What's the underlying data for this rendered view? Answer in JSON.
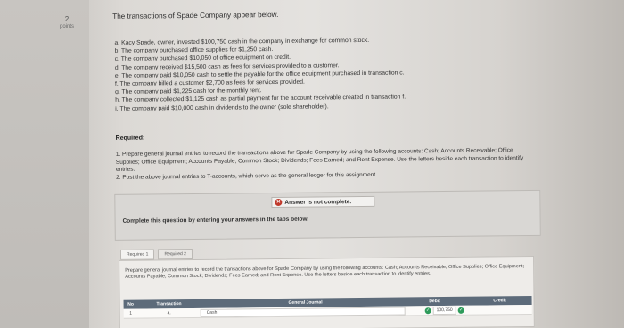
{
  "question": {
    "points_value": "2",
    "points_label": "points",
    "intro": "The transactions of Spade Company appear below.",
    "transactions": [
      "a. Kacy Spade, owner, invested $100,750 cash in the company in exchange for common stock.",
      "b. The company purchased office supplies for $1,250 cash.",
      "c. The company purchased $10,050 of office equipment on credit.",
      "d. The company received $15,500 cash as fees for services provided to a customer.",
      "e. The company paid $10,050 cash to settle the payable for the office equipment purchased in transaction c.",
      "f. The company billed a customer $2,700 as fees for services provided.",
      "g. The company paid $1,225 cash for the monthly rent.",
      "h. The company collected $1,125 cash as partial payment for the account receivable created in transaction f.",
      "i. The company paid $10,000 cash in dividends to the owner (sole shareholder)."
    ],
    "required_label": "Required:",
    "requirements": [
      "1. Prepare general journal entries to record the transactions above for Spade Company by using the following accounts: Cash; Accounts Receivable; Office Supplies; Office Equipment; Accounts Payable; Common Stock; Dividends; Fees Earned; and Rent Expense. Use the letters beside each transaction to identify entries.",
      "2. Post the above journal entries to T-accounts, which serve as the general ledger for this assignment."
    ]
  },
  "answer": {
    "status": "Answer is not complete.",
    "instruction": "Complete this question by entering your answers in the tabs below."
  },
  "tabs": [
    {
      "label": "Required 1"
    },
    {
      "label": "Required 2"
    }
  ],
  "panel": {
    "text": "Prepare general journal entries to record the transactions above for Spade Company by using the following accounts: Cash; Accounts Receivable; Office Supplies; Office Equipment; Accounts Payable; Common Stock; Dividends; Fees Earned; and Rent Expense. Use the letters beside each transaction to identify entries."
  },
  "journal": {
    "headers": {
      "no": "No",
      "transaction": "Transaction",
      "account": "General Journal",
      "debit": "Debit",
      "credit": "Credit"
    },
    "rows": [
      {
        "no": "1",
        "transaction": "a.",
        "account": "Cash",
        "debit": "100,750",
        "credit": ""
      }
    ]
  },
  "colors": {
    "header_bg": "#5d6b7a",
    "error": "#c0392b",
    "success": "#2e9b5b"
  }
}
